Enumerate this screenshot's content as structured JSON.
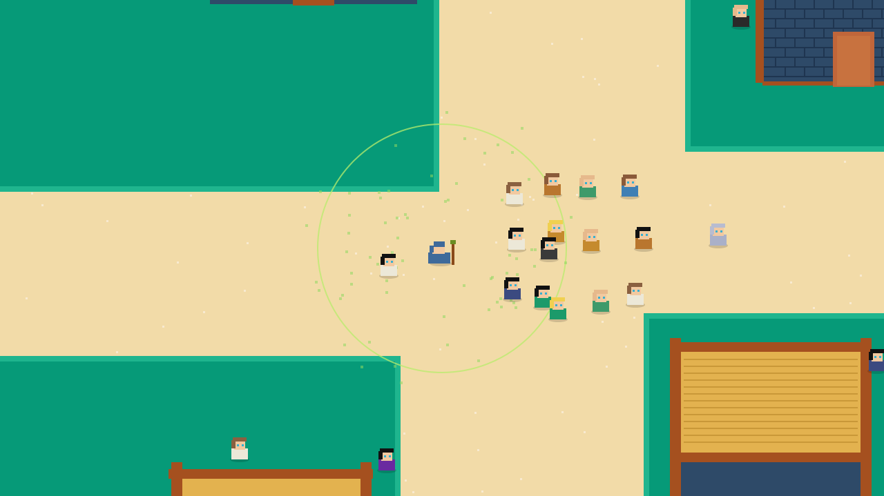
{
  "colors": {
    "sand": "#f2dba8",
    "sand_speck": "#f8ead0",
    "grass": "#069a78",
    "grass_edge": "#1fb58e",
    "wood": "#a5501f",
    "wood_dark": "#7a3a14",
    "brick": "#2e4a68",
    "brick_line": "#1f3550",
    "door": "#c0663a",
    "thatch": "#e3b24f",
    "thatch_line": "#c99838",
    "aoe_ring": "#b8ec6c",
    "aoe_particle": "#8fd860"
  },
  "buildings": [
    {
      "kind": "brick-house",
      "name": "house-top-right",
      "has_door": true
    },
    {
      "kind": "thatch-hut",
      "name": "hut-bottom-right"
    },
    {
      "kind": "thatch-hut",
      "name": "hut-bottom-center"
    },
    {
      "kind": "plank-edge",
      "name": "building-top-edge"
    }
  ],
  "spell_effect": {
    "name": "green-magic-aura",
    "style": "dashed-ring"
  },
  "player": {
    "name": "player-wizard",
    "robe": "#3f6a9a",
    "hat": "#3f6a9a",
    "staff": "#6b8e23"
  },
  "characters": [
    {
      "name": "villager-white-robe-1",
      "hair": "#111111",
      "robe": "#ece8d8"
    },
    {
      "name": "villager-white-robe-2",
      "hair": "#8a6040",
      "robe": "#ece8d8"
    },
    {
      "name": "villager-brown-robe-1",
      "hair": "#8a5a3a",
      "robe": "#b9762e"
    },
    {
      "name": "villager-bald-green",
      "hair": "#e6b98c",
      "robe": "#3e9a6a"
    },
    {
      "name": "villager-blue-robe",
      "hair": "#8a5a3a",
      "robe": "#3f7fb4"
    },
    {
      "name": "villager-white-robe-3",
      "hair": "#111111",
      "robe": "#ece8d8"
    },
    {
      "name": "villager-blonde",
      "hair": "#f0d050",
      "robe": "#c58a2e"
    },
    {
      "name": "villager-bald-orange",
      "hair": "#e6b98c",
      "robe": "#c58a2e"
    },
    {
      "name": "villager-brown-robe-2",
      "hair": "#111111",
      "robe": "#b9762e"
    },
    {
      "name": "villager-dark-small",
      "hair": "#111111",
      "robe": "#3a3a3a"
    },
    {
      "name": "villager-navy",
      "hair": "#111111",
      "robe": "#3b4a80"
    },
    {
      "name": "villager-green-robe",
      "hair": "#111111",
      "robe": "#1c9a6a"
    },
    {
      "name": "villager-blonde-green",
      "hair": "#f0d050",
      "robe": "#1c9a6a"
    },
    {
      "name": "villager-bald-green-2",
      "hair": "#e6b98c",
      "robe": "#3e9a6a"
    },
    {
      "name": "villager-white-robe-4",
      "hair": "#8a6040",
      "robe": "#ece8d8"
    },
    {
      "name": "knight-armored",
      "hair": "#b8bcd0",
      "robe": "#aab0c8"
    },
    {
      "name": "villager-top-right",
      "hair": "#e6b98c",
      "robe": "#2a2a2a"
    },
    {
      "name": "villager-grass-bottom",
      "hair": "#8a6040",
      "robe": "#ece8d8"
    },
    {
      "name": "villager-purple",
      "hair": "#111111",
      "robe": "#6a2aa0"
    },
    {
      "name": "villager-edge-right",
      "hair": "#111111",
      "robe": "#3b4a80"
    }
  ]
}
